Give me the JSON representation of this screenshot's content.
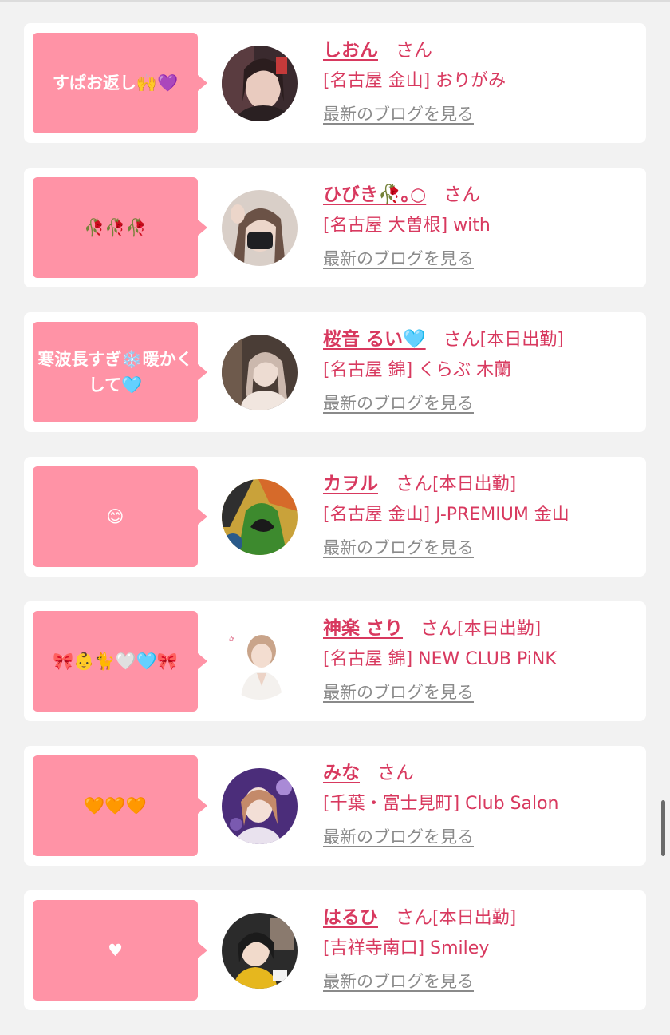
{
  "items": [
    {
      "message": "すぱお返し🙌💜",
      "name": "しおん",
      "honorific": "さん",
      "shift": "",
      "shop": "[名古屋 金山] おりがみ",
      "blog_link": "最新のブログを見る"
    },
    {
      "message": "🥀🥀🥀",
      "name": "ひびき🥀｡○",
      "honorific": "さん",
      "shift": "",
      "shop": "[名古屋 大曽根] with",
      "blog_link": "最新のブログを見る"
    },
    {
      "message": "寒波長すぎ❄️暖かくして🩵",
      "name": "桜音 るい🩵",
      "honorific": "さん",
      "shift": "[本日出勤]",
      "shop": "[名古屋 錦] くらぶ 木蘭",
      "blog_link": "最新のブログを見る"
    },
    {
      "message": "😊",
      "name": "カヲル",
      "honorific": "さん",
      "shift": "[本日出勤]",
      "shop": "[名古屋 金山] J-PREMIUM 金山",
      "blog_link": "最新のブログを見る"
    },
    {
      "message": "🎀👶🐈🤍🩵🎀",
      "name": "神楽 さり",
      "honorific": "さん",
      "shift": "[本日出勤]",
      "shop": "[名古屋 錦] NEW CLUB PiNK",
      "blog_link": "最新のブログを見る"
    },
    {
      "message": "🧡🧡🧡",
      "name": "みな",
      "honorific": "さん",
      "shift": "",
      "shop": "[千葉・富士見町] Club Salon",
      "blog_link": "最新のブログを見る"
    },
    {
      "message": "♥",
      "name": "はるひ",
      "honorific": "さん",
      "shift": "[本日出勤]",
      "shop": "[吉祥寺南口] Smiley",
      "blog_link": "最新のブログを見る"
    }
  ],
  "colors": {
    "accent": "#d8395f",
    "bubble": "#ff93a6",
    "link_gray": "#8a8a8a",
    "background": "#f2f2f2"
  }
}
